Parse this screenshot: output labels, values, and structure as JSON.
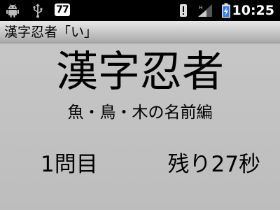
{
  "status_bar": {
    "notification_count": "77",
    "time": "10:25",
    "icons": [
      "android-robot-icon",
      "usb-icon",
      "alert-icon",
      "signal-icon",
      "battery-charging-icon"
    ]
  },
  "app": {
    "title": "漢字忍者「い」"
  },
  "main": {
    "title": "漢字忍者",
    "subtitle": "魚・鳥・木の名前編",
    "question_number": "1問目",
    "time_left": "残り27秒"
  }
}
